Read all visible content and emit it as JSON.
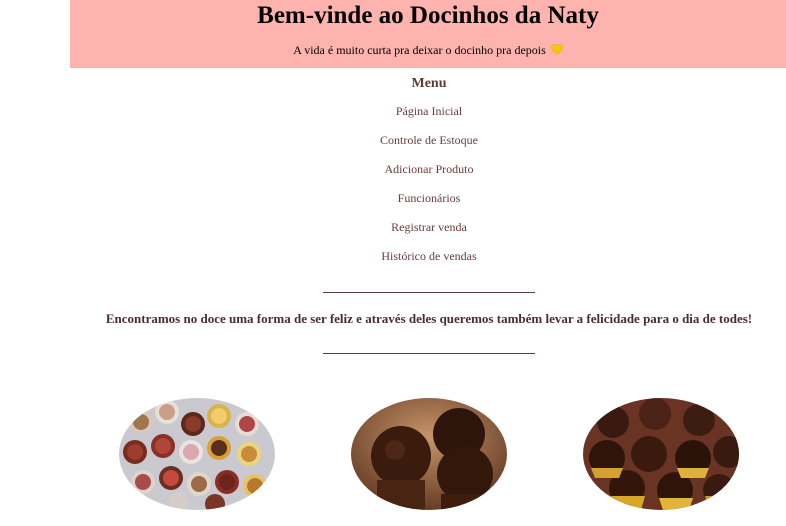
{
  "header": {
    "title": "Bem-vinde ao Docinhos da Naty",
    "subtitle": "A vida é muito curta pra deixar o docinho pra depois",
    "heart_icon": "yellow-heart-icon",
    "background_color": "#ffb3ae"
  },
  "menu": {
    "title": "Menu",
    "items": [
      {
        "label": "Página Inicial"
      },
      {
        "label": "Controle de Estoque"
      },
      {
        "label": "Adicionar Produto"
      },
      {
        "label": "Funcionários"
      },
      {
        "label": "Registrar venda"
      },
      {
        "label": "Histórico de vendas"
      }
    ],
    "link_color": "#6b3b3b"
  },
  "tagline": "Encontramos no doce uma forma de ser feliz e através deles queremos também levar a felicidade para o dia de todes!",
  "gallery": {
    "images": [
      {
        "name": "assorted-brigadeiros-image"
      },
      {
        "name": "chocolate-brigadeiros-image"
      },
      {
        "name": "brigadeiros-gold-cups-image"
      }
    ]
  }
}
